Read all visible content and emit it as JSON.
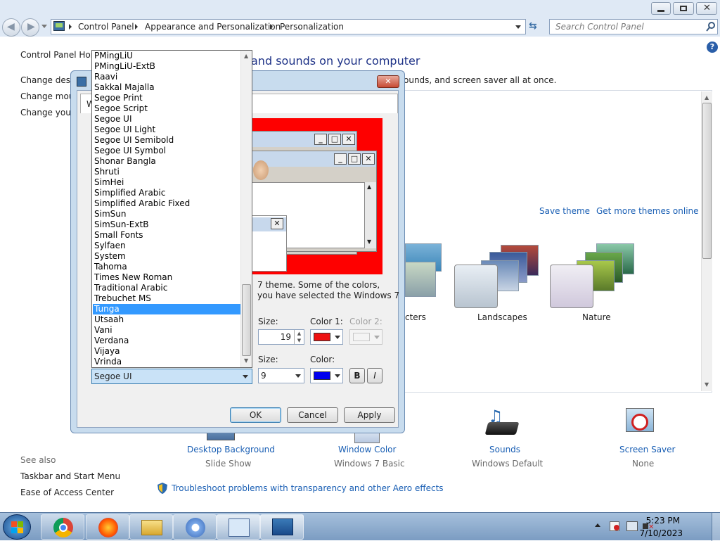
{
  "breadcrumb": [
    "Control Panel",
    "Appearance and Personalization",
    "Personalization"
  ],
  "search": {
    "placeholder": "Search Control Panel"
  },
  "left_pane": {
    "home": "Control Panel Home",
    "links": [
      "Change desktop icons",
      "Change mouse pointers",
      "Change your account picture"
    ],
    "see_also_label": "See also",
    "see_also": [
      "Taskbar and Start Menu",
      "Ease of Access Center"
    ]
  },
  "main": {
    "heading": "and sounds on your computer",
    "subheading": "ounds, and screen saver all at once.",
    "save_theme": "Save theme",
    "get_more_themes": "Get more themes online",
    "themes": [
      {
        "label": "cters"
      },
      {
        "label": "Landscapes"
      },
      {
        "label": "Nature"
      }
    ],
    "bottom": [
      {
        "title": "Desktop Background",
        "sub": "Slide Show"
      },
      {
        "title": "Window Color",
        "sub": "Windows 7 Basic"
      },
      {
        "title": "Sounds",
        "sub": "Windows Default"
      },
      {
        "title": "Screen Saver",
        "sub": "None"
      }
    ],
    "troubleshoot": "Troubleshoot problems with transparency and other Aero effects"
  },
  "dialog": {
    "tab_letter": "W",
    "close_glyph": "✕",
    "description_line1": "7 theme.  Some of the colors,",
    "description_line2": "you have selected the Windows 7",
    "item_size_label": "Size:",
    "item_size_value": "19",
    "color1_label": "Color 1:",
    "color2_label": "Color 2:",
    "color1": "#ee1111",
    "font_size_label": "Size:",
    "font_size_value": "9",
    "font_color_label": "Color:",
    "font_color": "#0000ee",
    "bold_label": "B",
    "italic_label": "I",
    "ok": "OK",
    "cancel": "Cancel",
    "apply": "Apply"
  },
  "font_list": {
    "items": [
      "PMingLiU",
      "PMingLiU-ExtB",
      "Raavi",
      "Sakkal Majalla",
      "Segoe Print",
      "Segoe Script",
      "Segoe UI",
      "Segoe UI Light",
      "Segoe UI Semibold",
      "Segoe UI Symbol",
      "Shonar Bangla",
      "Shruti",
      "SimHei",
      "Simplified Arabic",
      "Simplified Arabic Fixed",
      "SimSun",
      "SimSun-ExtB",
      "Small Fonts",
      "Sylfaen",
      "System",
      "Tahoma",
      "Times New Roman",
      "Traditional Arabic",
      "Trebuchet MS",
      "Tunga",
      "Utsaah",
      "Vani",
      "Verdana",
      "Vijaya",
      "Vrinda"
    ],
    "highlighted": "Tunga",
    "selected_value": "Segoe UI"
  },
  "taskbar": {
    "apps": [
      "chrome-icon",
      "firefox-icon",
      "file-explorer-icon",
      "chromium-icon",
      "control-panel-icon",
      "personalization-icon"
    ],
    "time": "5:23 PM",
    "date": "7/10/2023"
  }
}
